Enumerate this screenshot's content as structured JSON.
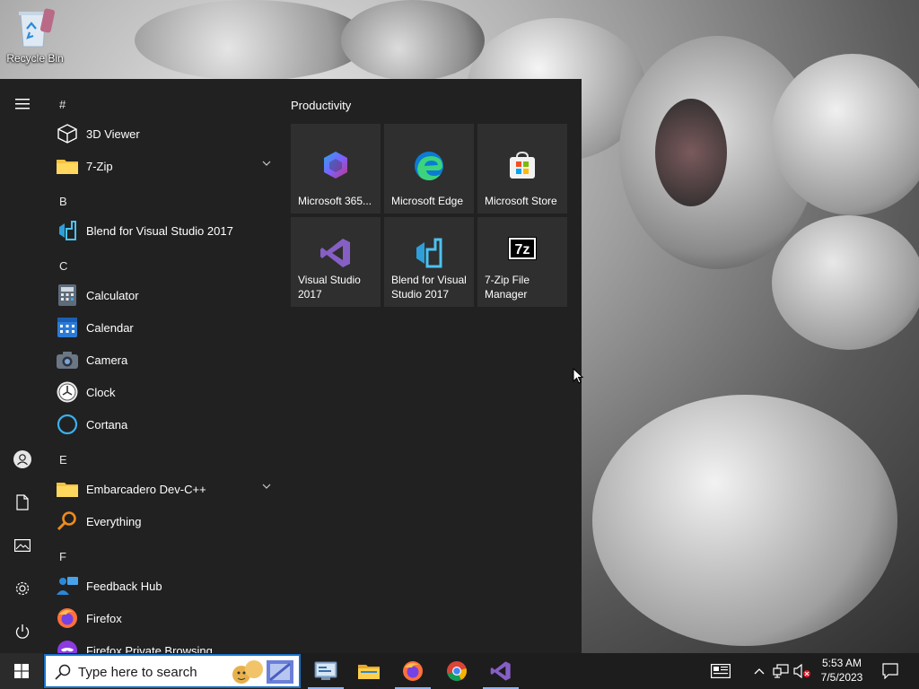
{
  "desktop": {
    "recycle_bin_label": "Recycle Bin"
  },
  "start_menu": {
    "letters": {
      "hash": "#",
      "b": "B",
      "c": "C",
      "e": "E",
      "f": "F"
    },
    "apps": {
      "viewer3d": "3D Viewer",
      "zip7": "7-Zip",
      "blend": "Blend for Visual Studio 2017",
      "calculator": "Calculator",
      "calendar": "Calendar",
      "camera": "Camera",
      "clock": "Clock",
      "cortana": "Cortana",
      "embarcadero": "Embarcadero Dev-C++",
      "everything": "Everything",
      "feedback": "Feedback Hub",
      "firefox": "Firefox",
      "firefox_private": "Firefox Private Browsing"
    },
    "tile_group_title": "Productivity",
    "tiles": {
      "m365": "Microsoft 365...",
      "edge": "Microsoft Edge",
      "store": "Microsoft Store",
      "vs2017": "Visual Studio 2017",
      "blend": "Blend for Visual Studio 2017",
      "zipfm": "7-Zip File Manager"
    }
  },
  "taskbar": {
    "search_placeholder": "Type here to search",
    "time": "5:53 AM",
    "date": "7/5/2023"
  },
  "colors": {
    "accent": "#1a73c8",
    "start_bg": "#212121",
    "tile_bg": "#2f2f2f",
    "taskbar_bg": "#1d1d1d"
  }
}
